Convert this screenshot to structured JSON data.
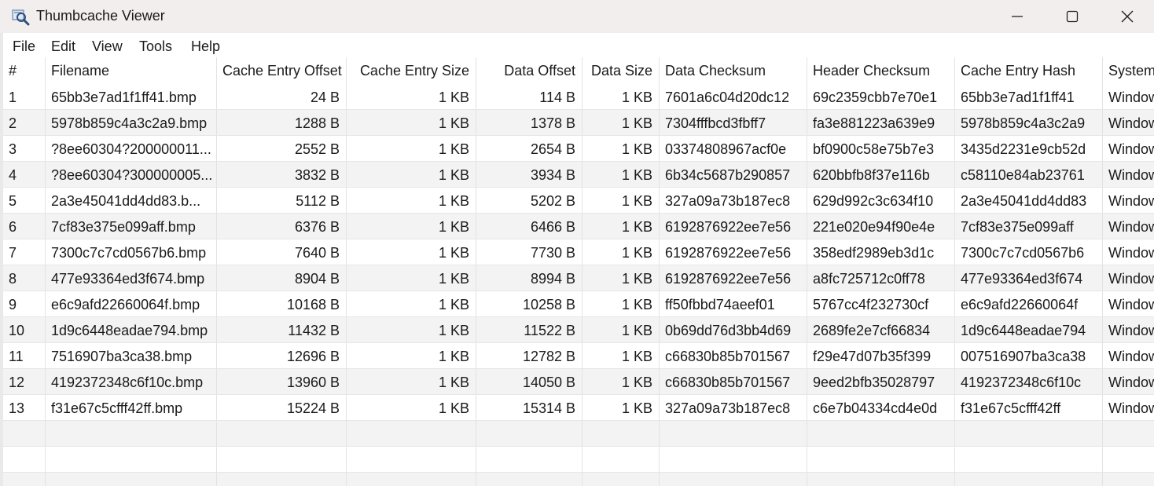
{
  "window": {
    "title": "Thumbcache Viewer",
    "icon": "magnifier-icon"
  },
  "window_controls": [
    "minimize-icon",
    "maximize-icon",
    "close-icon"
  ],
  "menu": [
    "File",
    "Edit",
    "View",
    "Tools",
    "Help"
  ],
  "table": {
    "headers": [
      "#",
      "Filename",
      "Cache Entry Offset",
      "Cache Entry Size",
      "Data Offset",
      "Data Size",
      "Data Checksum",
      "Header Checksum",
      "Cache Entry Hash",
      "System"
    ],
    "rows": [
      [
        "1",
        "65bb3e7ad1f1ff41.bmp",
        "24 B",
        "1 KB",
        "114 B",
        "1 KB",
        "7601a6c04d20dc12",
        "69c2359cbb7e70e1",
        "65bb3e7ad1f1ff41",
        "Window"
      ],
      [
        "2",
        "5978b859c4a3c2a9.bmp",
        "1288 B",
        "1 KB",
        "1378 B",
        "1 KB",
        "7304fffbcd3fbff7",
        "fa3e881223a639e9",
        "5978b859c4a3c2a9",
        "Window"
      ],
      [
        "3",
        "?8ee60304?200000011...",
        "2552 B",
        "1 KB",
        "2654 B",
        "1 KB",
        "03374808967acf0e",
        "bf0900c58e75b7e3",
        "3435d2231e9cb52d",
        "Window"
      ],
      [
        "4",
        "?8ee60304?300000005...",
        "3832 B",
        "1 KB",
        "3934 B",
        "1 KB",
        "6b34c5687b290857",
        "620bbfb8f37e116b",
        "c58110e84ab23761",
        "Window"
      ],
      [
        "5",
        "2a3e45041dd4dd83.b...",
        "5112 B",
        "1 KB",
        "5202 B",
        "1 KB",
        "327a09a73b187ec8",
        "629d992c3c634f10",
        "2a3e45041dd4dd83",
        "Window"
      ],
      [
        "6",
        "7cf83e375e099aff.bmp",
        "6376 B",
        "1 KB",
        "6466 B",
        "1 KB",
        "6192876922ee7e56",
        "221e020e94f90e4e",
        "7cf83e375e099aff",
        "Window"
      ],
      [
        "7",
        "7300c7c7cd0567b6.bmp",
        "7640 B",
        "1 KB",
        "7730 B",
        "1 KB",
        "6192876922ee7e56",
        "358edf2989eb3d1c",
        "7300c7c7cd0567b6",
        "Window"
      ],
      [
        "8",
        "477e93364ed3f674.bmp",
        "8904 B",
        "1 KB",
        "8994 B",
        "1 KB",
        "6192876922ee7e56",
        "a8fc725712c0ff78",
        "477e93364ed3f674",
        "Window"
      ],
      [
        "9",
        "e6c9afd22660064f.bmp",
        "10168 B",
        "1 KB",
        "10258 B",
        "1 KB",
        "ff50fbbd74aeef01",
        "5767cc4f232730cf",
        "e6c9afd22660064f",
        "Window"
      ],
      [
        "10",
        "1d9c6448eadae794.bmp",
        "11432 B",
        "1 KB",
        "11522 B",
        "1 KB",
        "0b69dd76d3bb4d69",
        "2689fe2e7cf66834",
        "1d9c6448eadae794",
        "Window"
      ],
      [
        "11",
        "7516907ba3ca38.bmp",
        "12696 B",
        "1 KB",
        "12782 B",
        "1 KB",
        "c66830b85b701567",
        "f29e47d07b35f399",
        "007516907ba3ca38",
        "Window"
      ],
      [
        "12",
        "4192372348c6f10c.bmp",
        "13960 B",
        "1 KB",
        "14050 B",
        "1 KB",
        "c66830b85b701567",
        "9eed2bfb35028797",
        "4192372348c6f10c",
        "Window"
      ],
      [
        "13",
        "f31e67c5cfff42ff.bmp",
        "15224 B",
        "1 KB",
        "15314 B",
        "1 KB",
        "327a09a73b187ec8",
        "c6e7b04334cd4e0d",
        "f31e67c5cfff42ff",
        "Window"
      ]
    ]
  }
}
